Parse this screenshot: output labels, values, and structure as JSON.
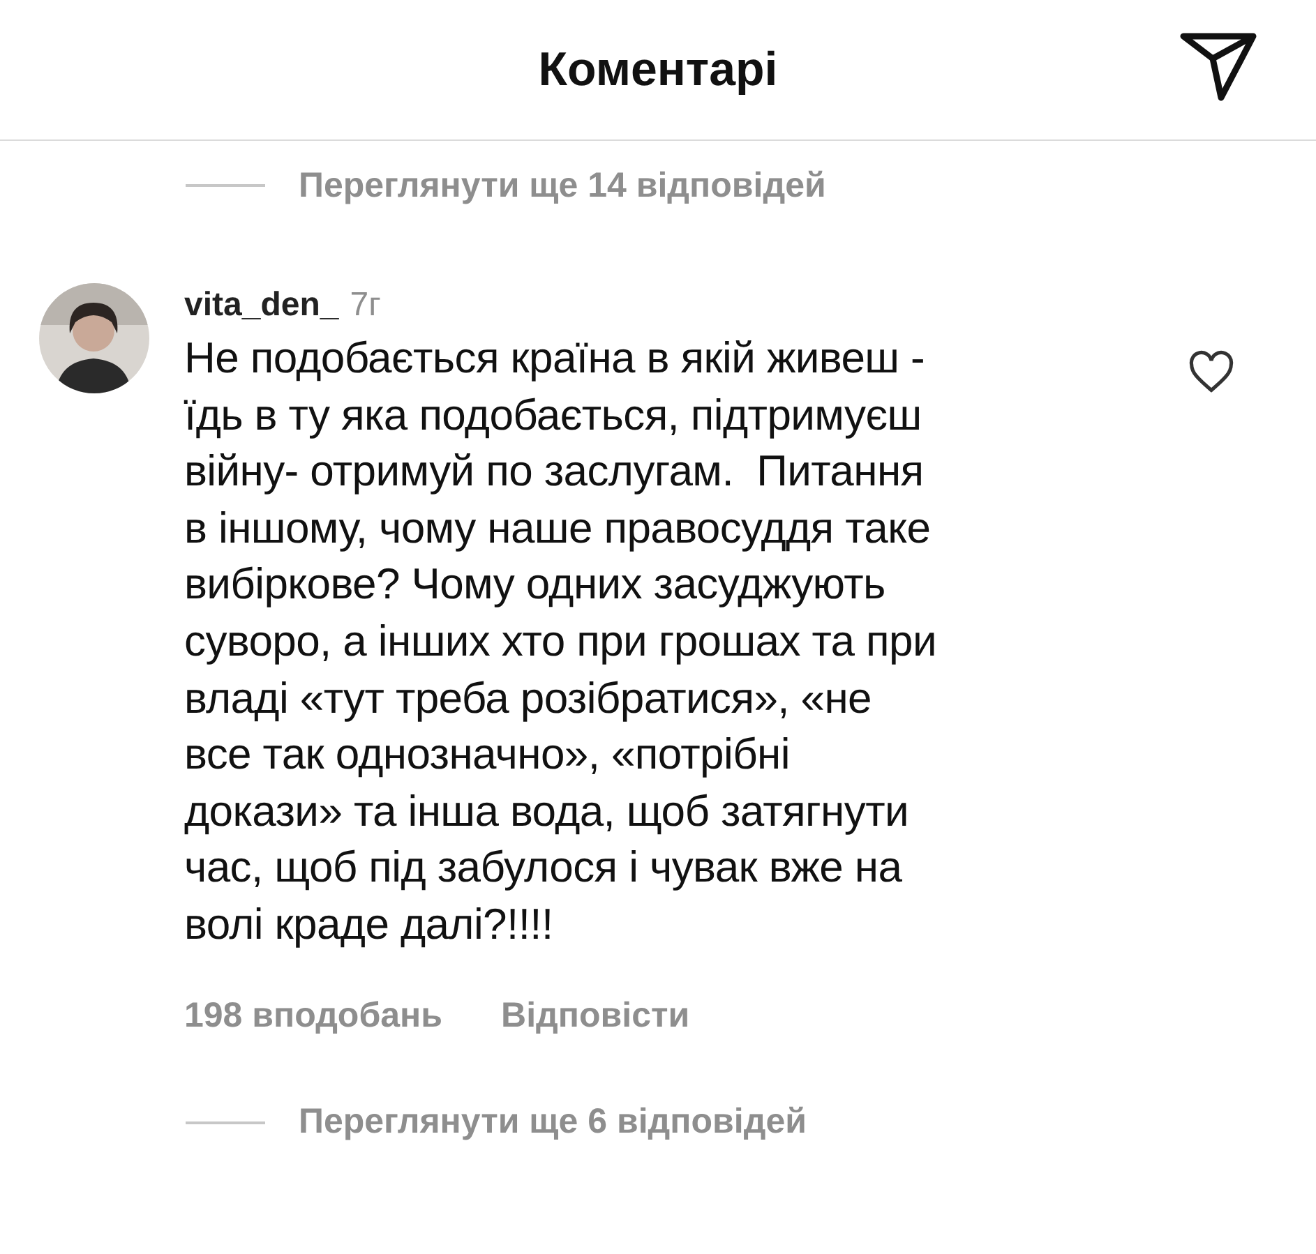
{
  "header": {
    "title": "Коментарі"
  },
  "view_more_top": {
    "label": "Переглянути ще 14 відповідей"
  },
  "comment": {
    "username": "vita_den_",
    "time": "7г",
    "liked": false,
    "text": "Не подобається країна в якій живеш -\nїдь в ту яка подобається, підтримуєш\nвійну- отримуй по заслугам.  Питання\nв іншому, чому наше правосуддя таке\nвибіркове? Чому одних засуджують\nсуворо, а інших хто при грошах та при\nвладі «тут треба розібратися», «не\nвсе так однозначно», «потрібні\nдокази» та інша вода, щоб затягнути\nчас, щоб під забулося і чувак вже на\nволі краде далі?!!!!",
    "likes": "198 вподобань",
    "reply": "Відповісти"
  },
  "view_more_bottom": {
    "label": "Переглянути ще 6 відповідей"
  }
}
